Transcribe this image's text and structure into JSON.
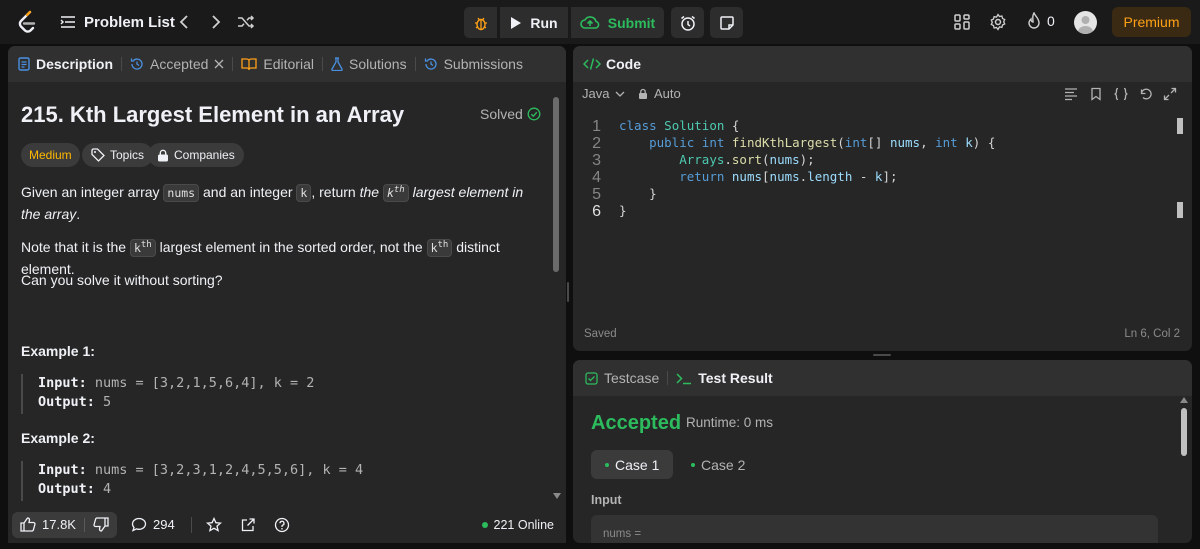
{
  "topbar": {
    "problem_list": "Problem List",
    "run": "Run",
    "submit": "Submit",
    "streak_count": "0",
    "premium": "Premium"
  },
  "left": {
    "tabs": [
      {
        "label": "Description"
      },
      {
        "label": "Accepted"
      },
      {
        "label": "Editorial"
      },
      {
        "label": "Solutions"
      },
      {
        "label": "Submissions"
      }
    ],
    "title": "215. Kth Largest Element in an Array",
    "solved": "Solved",
    "difficulty": "Medium",
    "topics": "Topics",
    "companies": "Companies",
    "para1": {
      "a": "Given an integer array ",
      "code1": "nums",
      "b": " and an integer ",
      "code2": "k",
      "c": ", return ",
      "d": "the ",
      "k": "k",
      "th": "th",
      "e": " largest element in the array",
      "f": "."
    },
    "para2": {
      "a": "Note that it is the ",
      "k": "k",
      "th": "th",
      "b": " largest element in the sorted order, not the ",
      "c": " distinct element."
    },
    "para3": "Can you solve it without sorting?",
    "examples": [
      {
        "heading": "Example 1:",
        "input_label": "Input:",
        "input": " nums = [3,2,1,5,6,4], k = 2",
        "output_label": "Output:",
        "output": " 5"
      },
      {
        "heading": "Example 2:",
        "input_label": "Input:",
        "input": " nums = [3,2,3,1,2,4,5,5,6], k = 4",
        "output_label": "Output:",
        "output": " 4"
      }
    ],
    "likes": "17.8K",
    "comments": "294",
    "online": "221 Online"
  },
  "code": {
    "tab": "Code",
    "language": "Java",
    "mode": "Auto",
    "lines": [
      "class Solution {",
      "    public int findKthLargest(int[] nums, int k) {",
      "        Arrays.sort(nums);",
      "        return nums[nums.length - k];",
      "    }",
      "}"
    ],
    "status": "Saved",
    "cursor": "Ln 6, Col 2"
  },
  "result": {
    "tab_testcase": "Testcase",
    "tab_result": "Test Result",
    "verdict": "Accepted",
    "runtime": "Runtime: 0 ms",
    "case1": "Case 1",
    "case2": "Case 2",
    "input_label": "Input",
    "input_first": "nums ="
  },
  "colors": {
    "accent_green": "#2cbb5d",
    "premium": "#ffa116",
    "medium": "#ffb800"
  }
}
